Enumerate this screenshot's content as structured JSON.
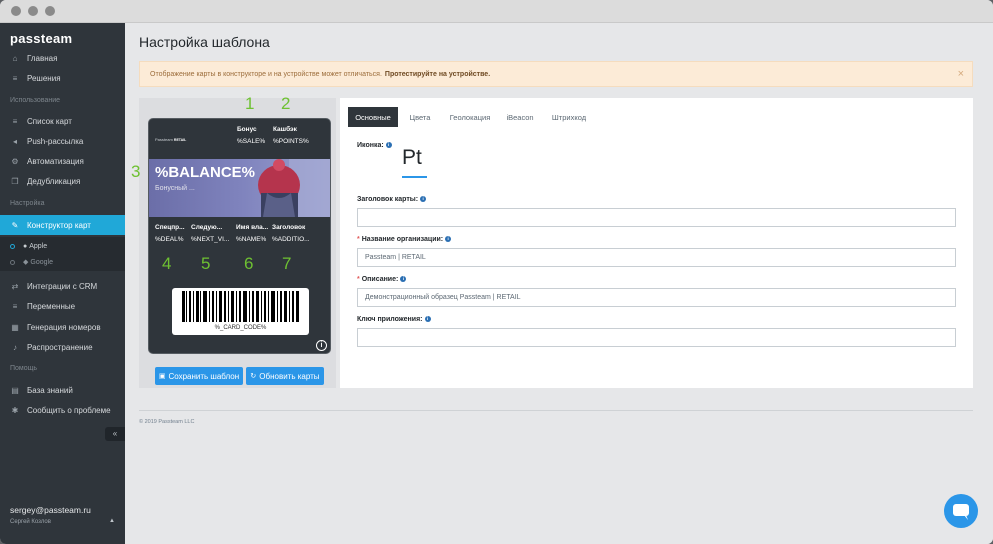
{
  "sidebar": {
    "logo": "passteam",
    "items": [
      {
        "label": "Главная",
        "icon": "home-icon"
      },
      {
        "label": "Решения",
        "icon": "list-icon"
      },
      {
        "label": "Список карт",
        "icon": "list-icon"
      },
      {
        "label": "Push-рассылка",
        "icon": "megaphone-icon"
      },
      {
        "label": "Автоматизация",
        "icon": "gear-icon"
      },
      {
        "label": "Дедубликация",
        "icon": "copy-icon"
      },
      {
        "label": "Конструктор карт",
        "icon": "brush-icon"
      },
      {
        "label": "Интеграции с CRM",
        "icon": "arrows-icon"
      },
      {
        "label": "Переменные",
        "icon": "list-icon"
      },
      {
        "label": "Генерация номеров",
        "icon": "grid-icon"
      },
      {
        "label": "Распространение",
        "icon": "bell-icon"
      },
      {
        "label": "База знаний",
        "icon": "book-icon"
      },
      {
        "label": "Сообщить о проблеме",
        "icon": "bug-icon"
      }
    ],
    "sections": [
      "Использование",
      "Настройка",
      "Помощь"
    ],
    "sub_items": [
      "Apple",
      "Google"
    ],
    "collapse": "«",
    "user_email": "sergey@passteam.ru",
    "user_name": "Сергей Козлов"
  },
  "page": {
    "title": "Настройка шаблона",
    "alert_text": "Отображение карты в конструкторе и на устройстве может отличаться.",
    "alert_bold": "Протестируйте на устройстве.",
    "alert_close": "×"
  },
  "card": {
    "numbers": [
      "1",
      "2",
      "3",
      "4",
      "5",
      "6",
      "7"
    ],
    "logo_main": "Passteam",
    "logo_sub": "RETAIL",
    "header": [
      {
        "label": "Бонус",
        "value": "%SALE%"
      },
      {
        "label": "Кашбэк",
        "value": "%POINTS%"
      }
    ],
    "balance": "%BALANCE%",
    "balance_label": "Бонусный ...",
    "fields": [
      {
        "label": "Спецпр...",
        "value": "%DEAL%"
      },
      {
        "label": "Следую...",
        "value": "%NEXT_VI..."
      },
      {
        "label": "Имя вла...",
        "value": "%NAME%"
      },
      {
        "label": "Заголовок",
        "value": "%ADDITIO..."
      }
    ],
    "barcode_text": "%_CARD_CODE%",
    "info": "i"
  },
  "buttons": {
    "save": "Сохранить шаблон",
    "refresh": "Обновить карты"
  },
  "tabs": [
    "Основные",
    "Цвета",
    "Геолокация",
    "iBeacon",
    "Штрихкод"
  ],
  "form": {
    "icon_label": "Иконка:",
    "icon_preview": "Pt",
    "card_title_label": "Заголовок карты:",
    "card_title_value": "",
    "org_label": "Название организации:",
    "org_value": "Passteam | RETAIL",
    "desc_label": "Описание:",
    "desc_value": "Демонстрационный образец Passteam | RETAIL",
    "key_label": "Ключ приложения:",
    "key_value": "",
    "req": "*",
    "info": "i"
  },
  "footer": {
    "copyright": "© 2019 Passteam LLC"
  },
  "colors": {
    "accent": "#20a8d8",
    "button": "#2b96e8",
    "sidebar_bg": "#2f353b",
    "number_green": "#6ec132"
  }
}
